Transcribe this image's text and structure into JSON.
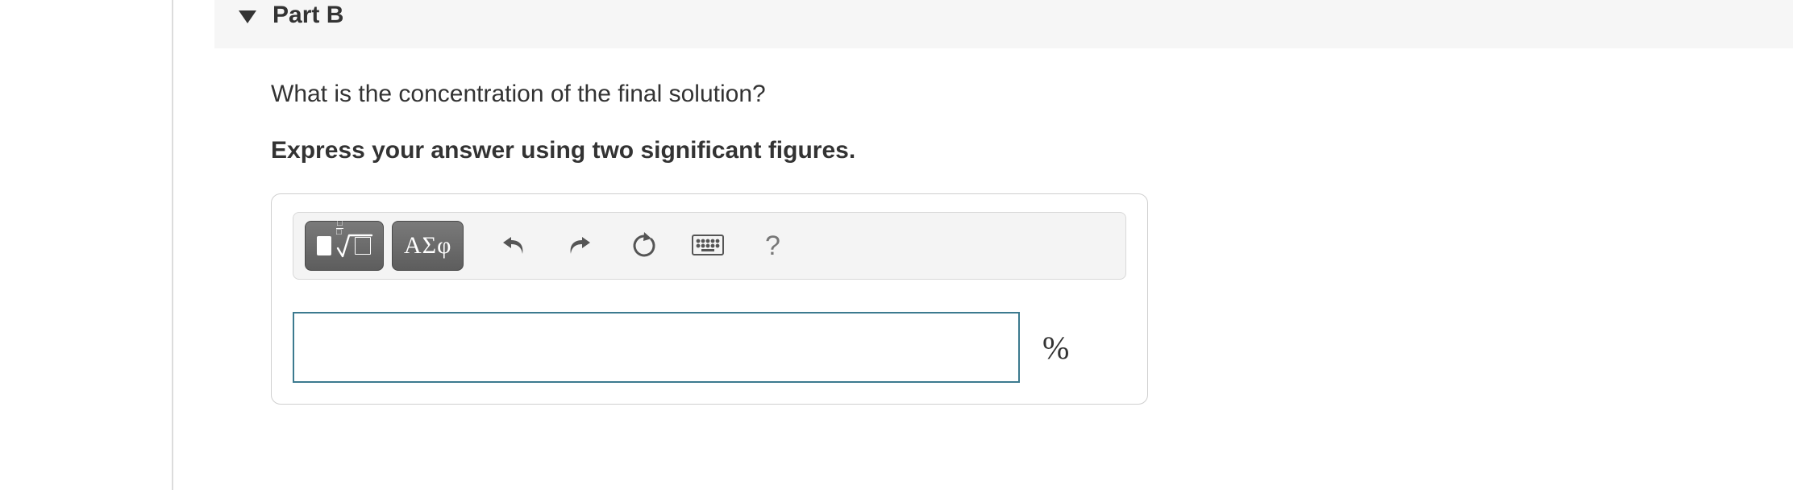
{
  "part": {
    "title": "Part B"
  },
  "question": {
    "prompt": "What is the concentration of the final solution?",
    "instruction": "Express your answer using two significant figures."
  },
  "toolbar": {
    "greek_label": "ΑΣφ",
    "help_label": "?"
  },
  "answer": {
    "value": "",
    "unit": "%"
  }
}
